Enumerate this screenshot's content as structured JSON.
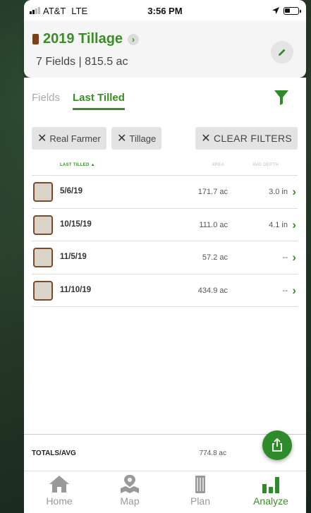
{
  "status_bar": {
    "carrier": "AT&T",
    "network": "LTE",
    "time": "3:56 PM"
  },
  "header": {
    "title": "2019 Tillage",
    "subtitle": "7 Fields | 815.5 ac"
  },
  "tabs": [
    {
      "label": "Fields",
      "active": false
    },
    {
      "label": "Last Tilled",
      "active": true
    }
  ],
  "filters": {
    "chips": [
      "Real Farmer",
      "Tillage"
    ],
    "clear_label": "CLEAR FILTERS"
  },
  "table": {
    "columns": {
      "last_tilled": "LAST TILLED ▲",
      "area": "AREA",
      "avg_depth": "AVG DEPTH"
    },
    "rows": [
      {
        "date": "5/6/19",
        "area": "171.7 ac",
        "depth": "3.0 in"
      },
      {
        "date": "10/15/19",
        "area": "111.0 ac",
        "depth": "4.1 in"
      },
      {
        "date": "11/5/19",
        "area": "57.2 ac",
        "depth": "--"
      },
      {
        "date": "11/10/19",
        "area": "434.9 ac",
        "depth": "--"
      }
    ]
  },
  "totals": {
    "label": "TOTALS/AVG",
    "area": "774.8 ac"
  },
  "tabbar": [
    {
      "label": "Home",
      "icon": "home-icon"
    },
    {
      "label": "Map",
      "icon": "map-icon"
    },
    {
      "label": "Plan",
      "icon": "plan-icon"
    },
    {
      "label": "Analyze",
      "icon": "analyze-icon",
      "active": true
    }
  ],
  "colors": {
    "accent": "#3c8c2a",
    "swatch": "#7a3e18",
    "checkbox_border": "#7a4a2a"
  }
}
